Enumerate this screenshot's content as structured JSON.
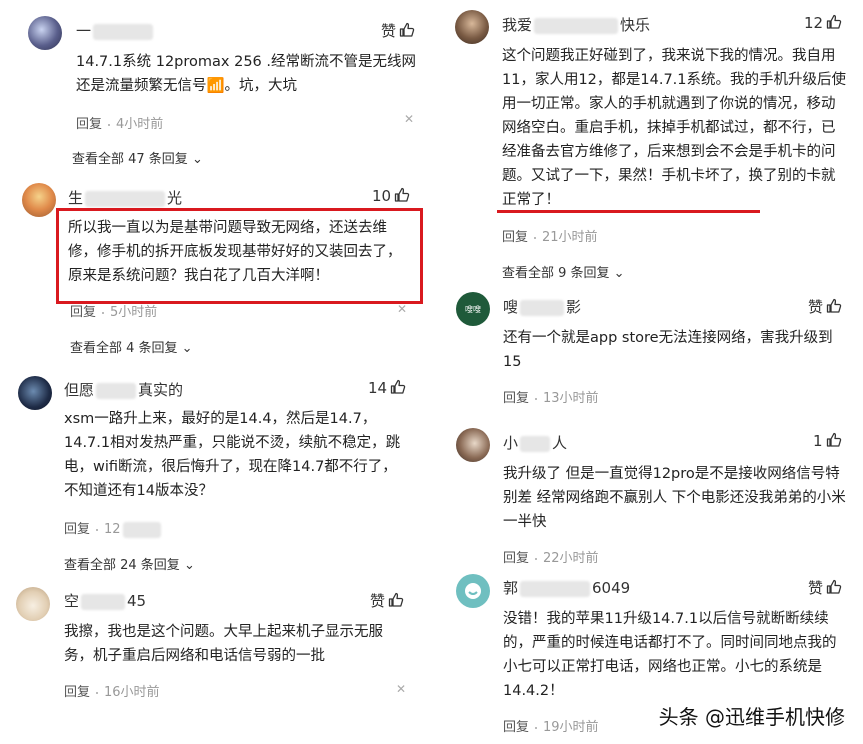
{
  "watermark": "头条 @迅维手机快修",
  "left": [
    {
      "name_pre": "一",
      "name_post": "",
      "like": "赞",
      "text": "14.7.1系统 12promax 256 .经常断流不管是无线网还是流量频繁无信号📶。坑，大坑",
      "reply": "回复",
      "time": "4小时前",
      "more": "查看全部 47 条回复"
    },
    {
      "name_pre": "生",
      "name_post": "光",
      "like": "10",
      "text": "所以我一直以为是基带问题导致无网络，还送去维修，修手机的拆开底板发现基带好好的又装回去了，原来是系统问题？我白花了几百大洋啊！",
      "reply": "回复",
      "time": "5小时前",
      "more": "查看全部 4 条回复"
    },
    {
      "name_pre": "但愿",
      "name_post": "真实的",
      "like": "14",
      "text": "xsm一路升上来，最好的是14.4，然后是14.7，14.7.1相对发热严重，只能说不烫，续航不稳定，跳电，wifi断流，很后悔升了，现在降14.7都不行了，不知道还有14版本没？",
      "reply": "回复",
      "time": "12",
      "more": "查看全部 24 条回复"
    },
    {
      "name_pre": "空",
      "name_post": "45",
      "like": "赞",
      "text": "我擦，我也是这个问题。大早上起来机子显示无服务，机子重启后网络和电话信号弱的一批",
      "reply": "回复",
      "time": "16小时前",
      "more": ""
    }
  ],
  "right": [
    {
      "name_pre": "我爱",
      "name_post": "快乐",
      "like": "12",
      "text": "这个问题我正好碰到了，我来说下我的情况。我自用11，家人用12，都是14.7.1系统。我的手机升级后使用一切正常。家人的手机就遇到了你说的情况，移动网络空白。重启手机，抹掉手机都试过，都不行，已经准备去官方维修了，后来想到会不会是手机卡的问题。又试了一下，果然！手机卡坏了，换了别的卡就正常了！",
      "reply": "回复",
      "time": "21小时前",
      "more": "查看全部 9 条回复"
    },
    {
      "name_pre": "嗖",
      "name_post": "影",
      "like": "赞",
      "avatar_text": "嗖嗖",
      "text": "还有一个就是app store无法连接网络，害我升级到15",
      "reply": "回复",
      "time": "13小时前",
      "more": ""
    },
    {
      "name_pre": "小",
      "name_post": "人",
      "like": "1",
      "text": "我升级了 但是一直觉得12pro是不是接收网络信号特别差 经常网络跑不赢别人 下个电影还没我弟弟的小米一半快",
      "reply": "回复",
      "time": "22小时前",
      "more": ""
    },
    {
      "name_pre": "郭",
      "name_post": "6049",
      "like": "赞",
      "text": "没错！我的苹果11升级14.7.1以后信号就断断续续的，严重的时候连电话都打不了。同时间同地点我的小七可以正常打电话，网络也正常。小七的系统是14.4.2！",
      "reply": "回复",
      "time": "19小时前",
      "more": ""
    }
  ]
}
